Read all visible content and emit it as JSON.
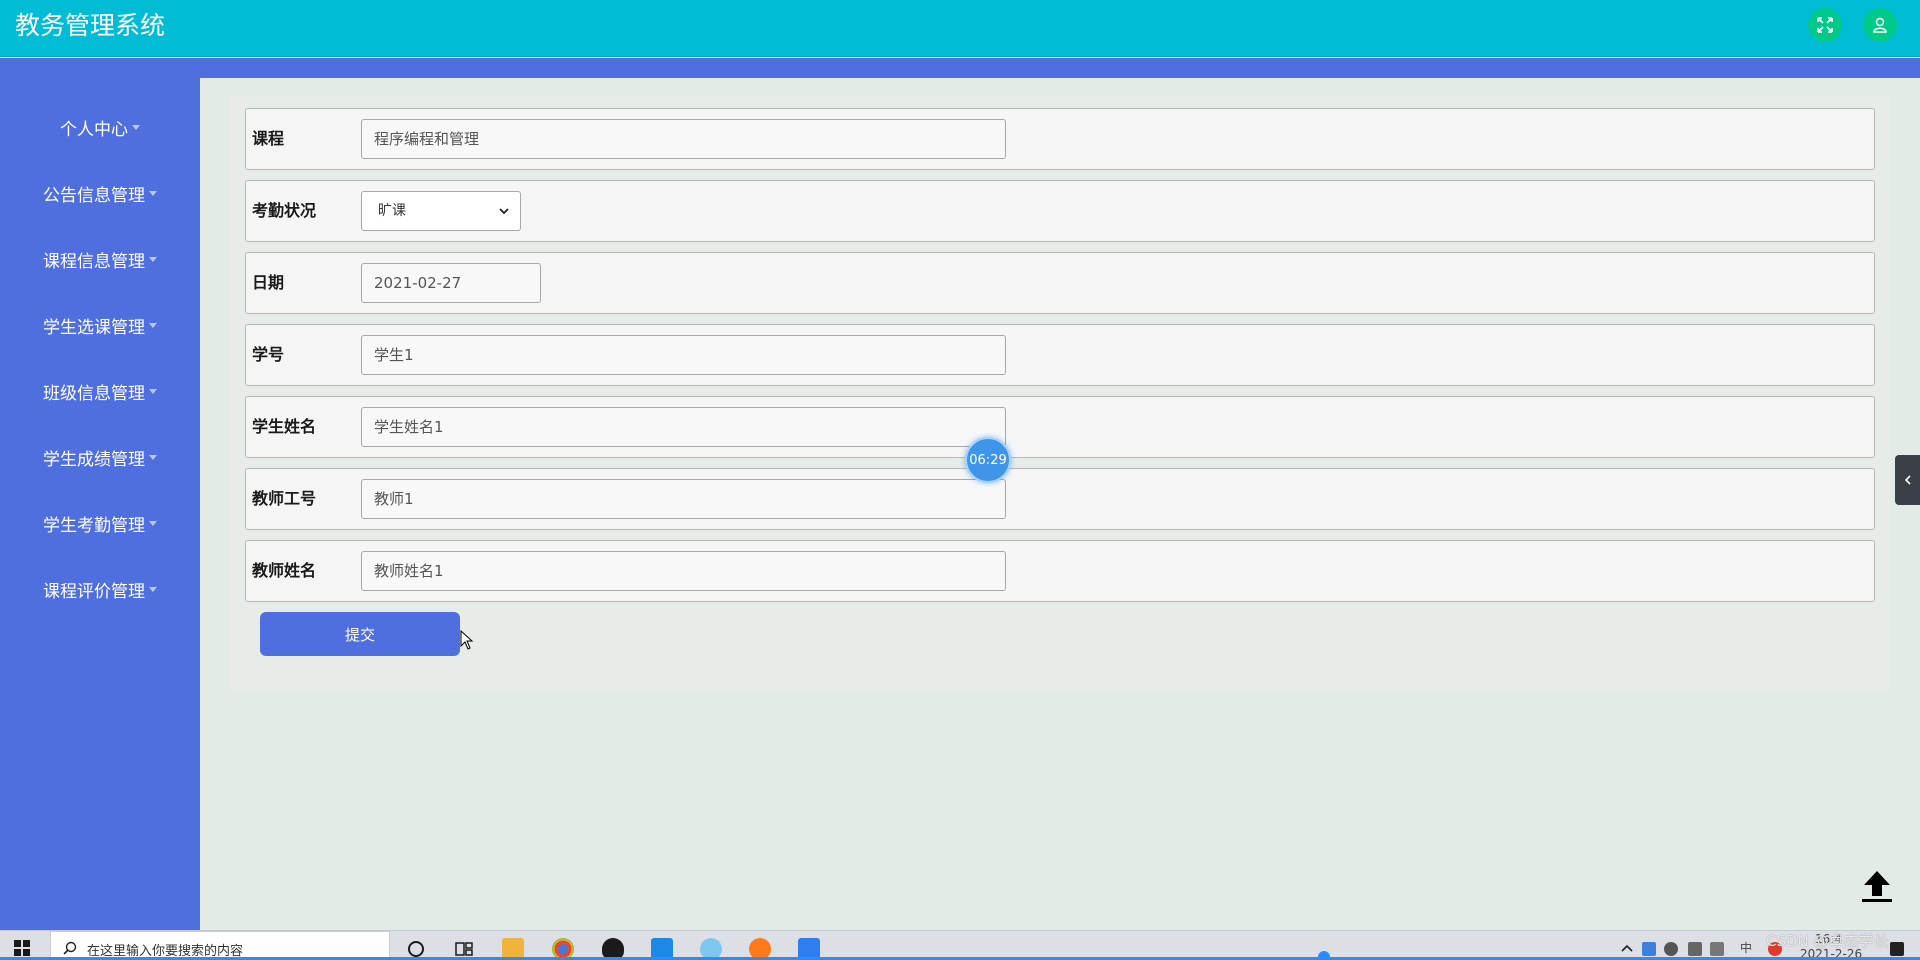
{
  "header": {
    "title": "教务管理系统",
    "fullscreen_icon": "fullscreen-icon",
    "user_icon": "user-icon"
  },
  "sidebar": {
    "items": [
      {
        "label": "个人中心"
      },
      {
        "label": "公告信息管理"
      },
      {
        "label": "课程信息管理"
      },
      {
        "label": "学生选课管理"
      },
      {
        "label": "班级信息管理"
      },
      {
        "label": "学生成绩管理"
      },
      {
        "label": "学生考勤管理"
      },
      {
        "label": "课程评价管理"
      }
    ]
  },
  "form": {
    "course": {
      "label": "课程",
      "value": "程序编程和管理"
    },
    "attendance": {
      "label": "考勤状况",
      "value": "旷课"
    },
    "date": {
      "label": "日期",
      "value": "2021-02-27"
    },
    "student_id": {
      "label": "学号",
      "value": "学生1"
    },
    "student_name": {
      "label": "学生姓名",
      "value": "学生姓名1"
    },
    "teacher_id": {
      "label": "教师工号",
      "value": "教师1"
    },
    "teacher_name": {
      "label": "教师姓名",
      "value": "教师姓名1"
    },
    "submit_label": "提交"
  },
  "overlay": {
    "timer": "06:29"
  },
  "taskbar": {
    "search_placeholder": "在这里输入你要搜索的内容",
    "ime_label": "中",
    "time": "16:4",
    "date": "2021-2-26",
    "watermark": "CSDN @卓杰学长"
  },
  "colors": {
    "header": "#00bcd4",
    "sidebar": "#4f6fde",
    "submit": "#4f6fde",
    "icon_button": "#00c98a"
  }
}
